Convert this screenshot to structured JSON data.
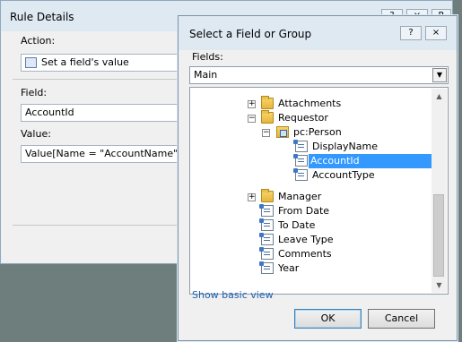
{
  "rule_details": {
    "title": "Rule Details",
    "help_btn": "?",
    "close_btn": "×",
    "action_label": "Action:",
    "action_value": "Set a field's value",
    "field_label": "Field:",
    "field_value": "AccountId",
    "value_label": "Value:",
    "value_value": "Value[Name = \"AccountName\"]",
    "edge_letter": "R"
  },
  "dialog": {
    "title": "Select a Field or Group",
    "help_btn": "?",
    "close_btn": "×",
    "fields_label": "Fields:",
    "fields_selected": "Main",
    "tree": [
      {
        "label": "Attachments",
        "expander": "+",
        "icon": "folder-icon"
      },
      {
        "label": "Requestor",
        "expander": "−",
        "icon": "folder-icon"
      },
      {
        "label": "pc:Person",
        "expander": "−",
        "icon": "group-icon"
      },
      {
        "label": "DisplayName",
        "icon": "field-icon"
      },
      {
        "label": "AccountId",
        "icon": "field-icon",
        "selected": true
      },
      {
        "label": "AccountType",
        "icon": "field-icon"
      },
      {
        "label": "Manager",
        "expander": "+",
        "icon": "folder-icon"
      },
      {
        "label": "From Date",
        "icon": "field-icon"
      },
      {
        "label": "To Date",
        "icon": "field-icon"
      },
      {
        "label": "Leave Type",
        "icon": "field-icon"
      },
      {
        "label": "Comments",
        "icon": "field-icon"
      },
      {
        "label": "Year",
        "icon": "field-icon"
      }
    ],
    "show_basic_view": "Show basic view",
    "ok": "OK",
    "cancel": "Cancel"
  },
  "colors": {
    "selection": "#3399ff",
    "link": "#1f5fb3",
    "titlebar": "#dfe9f2"
  }
}
